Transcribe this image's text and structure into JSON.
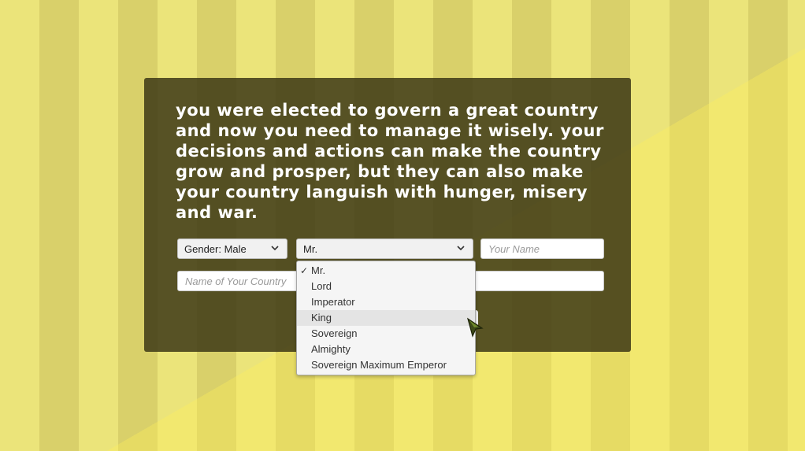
{
  "intro_text": "You were elected to govern a great country and now you need to manage it wisely. Your decisions and actions can make the country grow and prosper, but they can also make your country languish with hunger, misery and war.",
  "form": {
    "gender_select": "Gender: Male",
    "title_select": "Mr.",
    "name_placeholder": "Your Name",
    "country_placeholder": "Name of Your Country"
  },
  "dropdown": {
    "selected": "Mr.",
    "hovered": "King",
    "options": [
      "Mr.",
      "Lord",
      "Imperator",
      "King",
      "Sovereign",
      "Almighty",
      "Sovereign Maximum Emperor"
    ]
  },
  "icons": {
    "chevron": "chevron-down-icon",
    "check": "checkmark-icon",
    "cursor": "arrow-cursor-icon"
  },
  "colors": {
    "panel": "#3a3614",
    "stripe_light": "#ebe47a",
    "stripe_dark": "#d9d06a",
    "text": "#ffffff"
  }
}
